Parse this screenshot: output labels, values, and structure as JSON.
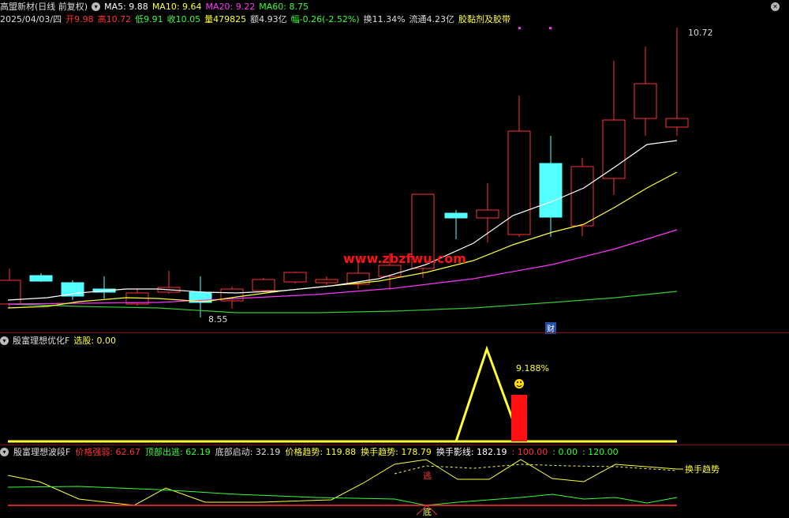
{
  "header": {
    "stock": "高盟新材(日线 前复权)",
    "ma": [
      {
        "label": "MA5: 9.88",
        "color": "#ffffff"
      },
      {
        "label": "MA10: 9.64",
        "color": "#ffff33"
      },
      {
        "label": "MA20: 9.22",
        "color": "#ff33ff"
      },
      {
        "label": "MA60: 8.75",
        "color": "#33ff33"
      }
    ]
  },
  "info": {
    "date": "2025/04/03/四",
    "open": "开9.98",
    "high": "高10.72",
    "low": "低9.91",
    "close": "收10.05",
    "volume": "量479825",
    "amount": "额4.93亿",
    "change": "幅-0.26(-2.52%)",
    "turnover": "换11.34%",
    "float": "流通4.23亿",
    "sector": "胶黏剂及胶带"
  },
  "main_chart": {
    "high_label": "10.72",
    "low_label": "8.55",
    "watermark": "www.zbzfwu.com",
    "finance_marker": "财"
  },
  "panel1": {
    "name": "殷富理想优化F",
    "field": "选股: 0.00",
    "value_label": "9.188%"
  },
  "panel2": {
    "name": "殷富理想波段F",
    "fields": [
      {
        "label": "价格强弱: 62.67",
        "color": "#ff3333"
      },
      {
        "label": "顶部出逃: 62.19",
        "color": "#33ff33"
      },
      {
        "label": "底部启动: 32.19",
        "color": "#dddddd"
      },
      {
        "label": "价格趋势: 119.88",
        "color": "#ffff33"
      },
      {
        "label": "换手趋势: 178.79",
        "color": "#ffff33"
      },
      {
        "label": "换手影线: 182.19",
        "color": "#ffffff"
      },
      {
        "label": ": 100.00",
        "color": "#ff3333"
      },
      {
        "label": ": 0.00",
        "color": "#33ff33"
      },
      {
        "label": ": 120.00",
        "color": "#33ff33"
      }
    ],
    "line_label": "换手趋势",
    "marker_top": "逃",
    "marker_bottom": "底"
  },
  "colors": {
    "up": "#ff3333",
    "down": "#54ffff",
    "ma5": "#ffffff",
    "ma10": "#ffff33",
    "ma20": "#ff33ff",
    "ma60": "#33cc33"
  }
}
